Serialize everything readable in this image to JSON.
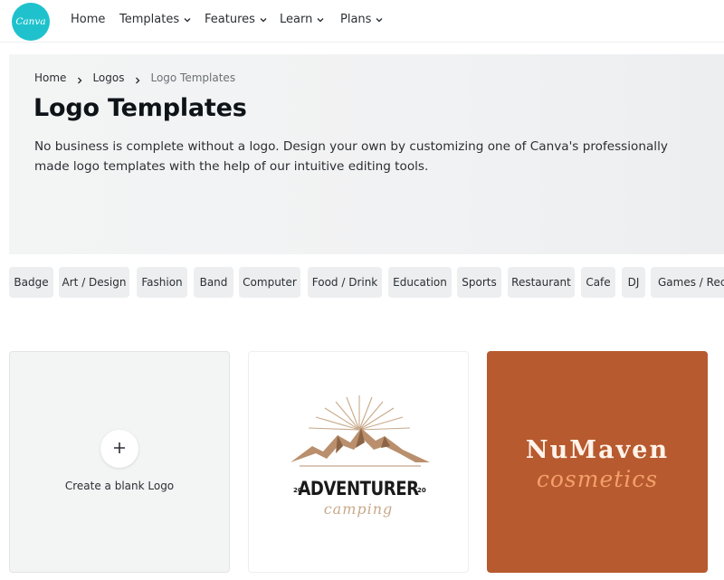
{
  "brand": {
    "name": "Canva",
    "color": "#1fc2cc"
  },
  "nav": {
    "items": [
      {
        "label": "Home",
        "dropdown": false
      },
      {
        "label": "Templates",
        "dropdown": true
      },
      {
        "label": "Features",
        "dropdown": true
      },
      {
        "label": "Learn",
        "dropdown": true
      },
      {
        "label": "Plans",
        "dropdown": true
      }
    ]
  },
  "breadcrumb": {
    "items": [
      "Home",
      "Logos",
      "Logo Templates"
    ]
  },
  "hero": {
    "title": "Logo Templates",
    "description": "No business is complete without a logo. Design your own by customizing one of Canva's professionally made logo templates with the help of our intuitive editing tools."
  },
  "categories": [
    "Badge",
    "Art / Design",
    "Fashion",
    "Band",
    "Computer",
    "Food / Drink",
    "Education",
    "Sports",
    "Restaurant",
    "Cafe",
    "DJ",
    "Games / Recreation"
  ],
  "cards": {
    "blank": {
      "label": "Create a blank Logo",
      "icon": "plus-icon"
    },
    "adventurer": {
      "title": "ADVENTURER",
      "subtitle": "camping",
      "year_left": "20",
      "year_right": "20"
    },
    "numaven": {
      "title": "NuMaven",
      "subtitle": "cosmetics",
      "background": "#b75a2f"
    }
  }
}
